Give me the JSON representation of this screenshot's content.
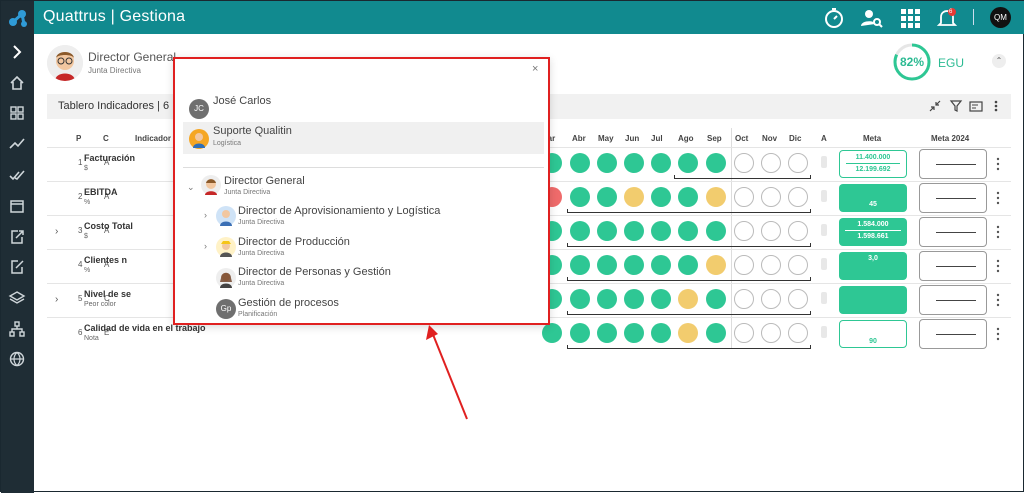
{
  "app": {
    "title": "Quattrus | Gestiona"
  },
  "topbar": {
    "icons": [
      "timer-icon",
      "user-search-icon",
      "apps-grid-icon",
      "bell-icon"
    ],
    "notification_count": "6",
    "user_initials": "QM"
  },
  "user": {
    "name": "Director General",
    "group": "Junta Directiva"
  },
  "score": {
    "value": "82%",
    "percent": 82,
    "label": "EGU"
  },
  "board": {
    "title": "Tablero Indicadores | 6"
  },
  "columns": {
    "p": "P",
    "c": "C",
    "indicator": "Indicador",
    "months": [
      "Mar",
      "Abr",
      "May",
      "Jun",
      "Jul",
      "Ago",
      "Sep",
      "Oct",
      "Nov",
      "Dic"
    ],
    "a": "A",
    "meta": "Meta",
    "meta2024": "Meta 2024"
  },
  "rows": [
    {
      "num": "1",
      "c": "A",
      "name": "Facturación",
      "unit": "$",
      "months": [
        "g",
        "g",
        "g",
        "g",
        "g",
        "g",
        "g",
        "e",
        "e",
        "e"
      ],
      "meta_top": "11.400.000",
      "meta_bottom": "12.199.692",
      "meta_style": "outline"
    },
    {
      "num": "2",
      "c": "A",
      "name": "EBITDA",
      "unit": "%",
      "months": [
        "r",
        "g",
        "g",
        "y",
        "g",
        "g",
        "y",
        "e",
        "e",
        "e"
      ],
      "meta_top": "",
      "meta_bottom": "45",
      "meta_style": "fill"
    },
    {
      "num": "3",
      "c": "A",
      "name": "Costo Total",
      "unit": "$",
      "months": [
        "g",
        "g",
        "g",
        "g",
        "g",
        "g",
        "g",
        "e",
        "e",
        "e"
      ],
      "meta_top": "1.584.000",
      "meta_bottom": "1.598.661",
      "meta_style": "fill"
    },
    {
      "num": "4",
      "c": "A",
      "name": "Clientes n",
      "unit": "%",
      "months": [
        "g",
        "g",
        "g",
        "g",
        "g",
        "g",
        "y",
        "e",
        "e",
        "e"
      ],
      "meta_top": "3,0",
      "meta_bottom": "",
      "meta_style": "fill"
    },
    {
      "num": "5",
      "c": "C",
      "name": "Nivel de se",
      "unit": "Peor color",
      "months": [
        "g",
        "g",
        "g",
        "g",
        "g",
        "y",
        "g",
        "e",
        "e",
        "e"
      ],
      "meta_top": "",
      "meta_bottom": "",
      "meta_style": "fill"
    },
    {
      "num": "6",
      "c": "E",
      "name": "Calidad de vida en el trabajo",
      "unit": "Nota",
      "months": [
        "g",
        "g",
        "g",
        "g",
        "g",
        "y",
        "g",
        "e",
        "e",
        "e"
      ],
      "meta_top": "",
      "meta_bottom": "90",
      "meta_style": "outline"
    }
  ],
  "popup": {
    "close": "×",
    "people": [
      {
        "initials": "JC",
        "name": "José Carlos",
        "sub": ""
      },
      {
        "initials": "",
        "name": "Suporte Qualitin",
        "sub": "Logística"
      }
    ],
    "tree": [
      {
        "name": "Director General",
        "sub": "Junta Directiva"
      },
      {
        "name": "Director de Aprovisionamiento y Logística",
        "sub": "Junta Directiva"
      },
      {
        "name": "Director de Producción",
        "sub": "Junta Directiva"
      },
      {
        "name": "Director de Personas y Gestión",
        "sub": "Junta Directiva"
      },
      {
        "initials": "Gp",
        "name": "Gestión de procesos",
        "sub": "Planificación"
      }
    ]
  },
  "colors": {
    "primary": "#118a8f",
    "sidebar": "#1f2d35",
    "green": "#2ec794",
    "yellow": "#f2cc6e",
    "red": "#ef6b6b",
    "highlight": "#e02020"
  }
}
